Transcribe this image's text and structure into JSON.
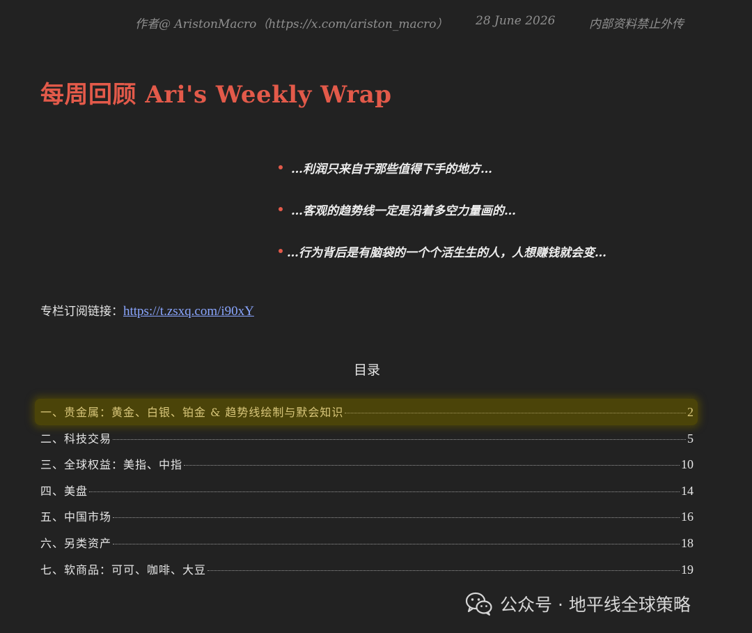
{
  "header": {
    "author": "作者@ AristonMacro（https://x.com/ariston_macro）",
    "date": "28 June 2026",
    "notice": "内部资料禁止外传"
  },
  "title": "每周回顾 Ari's Weekly Wrap",
  "quotes": [
    "…利润只来自于那些值得下手的地方…",
    "…客观的趋势线一定是沿着多空力量画的…",
    "…行为背后是有脑袋的一个个活生生的人，人想赚钱就会变…"
  ],
  "subscribe": {
    "label": "专栏订阅链接：",
    "url": "https://t.zsxq.com/i90xY"
  },
  "toc": {
    "heading": "目录",
    "items": [
      {
        "title": "一、贵金属：黄金、白银、铂金 & 趋势线绘制与默会知识",
        "page": "2"
      },
      {
        "title": "二、科技交易",
        "page": "5"
      },
      {
        "title": "三、全球权益：美指、中指",
        "page": "10"
      },
      {
        "title": "四、美盘",
        "page": "14"
      },
      {
        "title": "五、中国市场",
        "page": "16"
      },
      {
        "title": "六、另类资产",
        "page": "18"
      },
      {
        "title": "七、软商品：可可、咖啡、大豆",
        "page": "19"
      }
    ]
  },
  "watermark": {
    "text": "公众号 · 地平线全球策略",
    "icon": "wechat-icon"
  },
  "colors": {
    "background": "#222222",
    "title": "#e35a4a",
    "bullet": "#e35a4a",
    "highlight": "#4b4409",
    "link": "#8aa6ff"
  }
}
